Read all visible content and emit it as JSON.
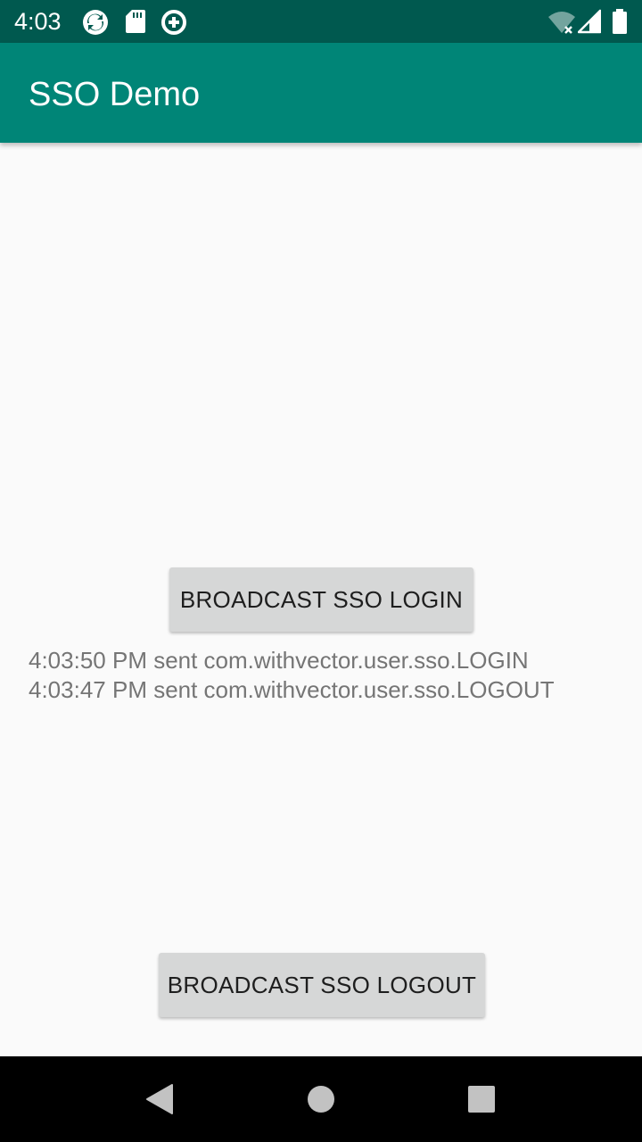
{
  "status_bar": {
    "time": "4:03",
    "icons": [
      "sync-icon",
      "sd-card-icon",
      "data-saver-icon",
      "wifi-off-icon",
      "cellular-signal-icon",
      "battery-icon"
    ]
  },
  "app_bar": {
    "title": "SSO Demo"
  },
  "main": {
    "login_button_label": "BROADCAST SSO LOGIN",
    "logout_button_label": "BROADCAST SSO LOGOUT",
    "log_lines": [
      "4:03:50 PM sent com.withvector.user.sso.LOGIN",
      "4:03:47 PM sent com.withvector.user.sso.LOGOUT"
    ]
  },
  "nav_bar": {
    "icons": [
      "back-icon",
      "home-icon",
      "recents-icon"
    ]
  },
  "colors": {
    "status_bar": "#00594f",
    "app_bar": "#008577",
    "background": "#fafafa",
    "button": "#d6d7d7",
    "log_text": "#757575"
  }
}
